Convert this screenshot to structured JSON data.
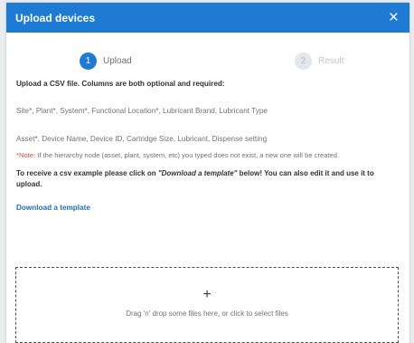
{
  "dialog": {
    "title": "Upload devices",
    "close_symbol": "×"
  },
  "stepper": {
    "steps": [
      {
        "number": "1",
        "label": "Upload",
        "state": "active"
      },
      {
        "number": "2",
        "label": "Result",
        "state": "inactive"
      }
    ]
  },
  "body": {
    "intro": "Upload a CSV file. Columns are both optional and required:",
    "columns_line1": "Site*, Plant*, System*, Functional Location*, Lubricant Brand, Lubricant Type",
    "columns_line2": "Asset*, Device Name, Device ID, Cartridge Size, Lubricant, Dispense setting",
    "note_prefix": "*Note:",
    "note_text": " If the hierarchy node (asset, plant, system, etc) you typed does not exist, a new one will be created.",
    "receive_prefix": "To receive a csv example please click on ",
    "receive_emphasis": "\"Download a template\"",
    "receive_suffix": " below! You can also edit it and use it to upload.",
    "download_link": "Download a template"
  },
  "dropzone": {
    "icon": "+",
    "text": "Drag 'n' drop some files here, or click to select files"
  },
  "colors": {
    "accent": "#1f7ad4",
    "note": "#e04a3c",
    "link": "#1f6fbf"
  },
  "icons": [
    "close-icon",
    "plus-icon"
  ]
}
